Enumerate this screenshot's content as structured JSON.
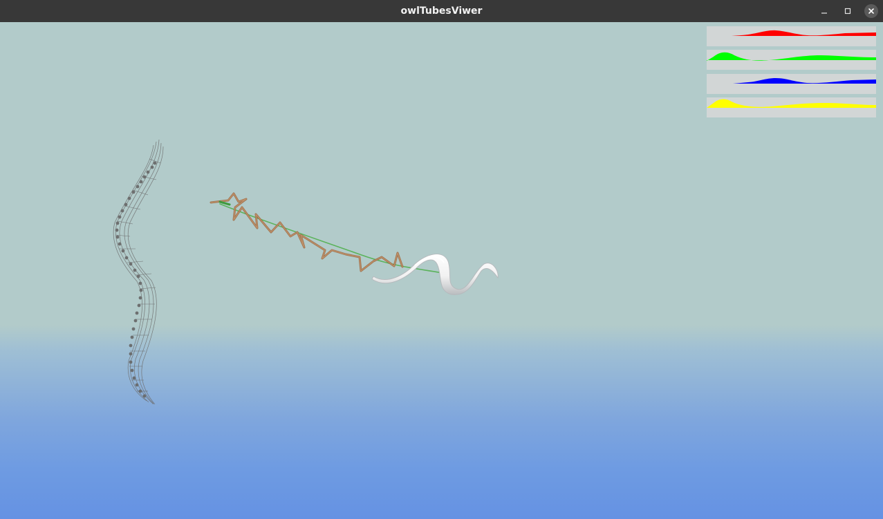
{
  "window": {
    "title": "owlTubesViwer",
    "controls": {
      "minimize_icon": "minimize-icon",
      "maximize_icon": "maximize-icon",
      "close_icon": "close-icon"
    }
  },
  "viewport": {
    "background_top": "#b2cbca",
    "background_bottom": "#6592e3"
  },
  "objects": [
    {
      "name": "wireframe-worm",
      "style": "wireframe",
      "color": "#707070"
    },
    {
      "name": "tube-trajectory",
      "style": "tubes",
      "color": "#a8734a",
      "centerline_color": "#5bb35b"
    },
    {
      "name": "shaded-worm",
      "style": "solid",
      "color": "#f0f0f0"
    }
  ],
  "transfer_functions": [
    {
      "channel": "red",
      "color": "#ff0000"
    },
    {
      "channel": "green",
      "color": "#00ff00"
    },
    {
      "channel": "blue",
      "color": "#0000ff"
    },
    {
      "channel": "alpha",
      "color": "#ffff00"
    }
  ]
}
